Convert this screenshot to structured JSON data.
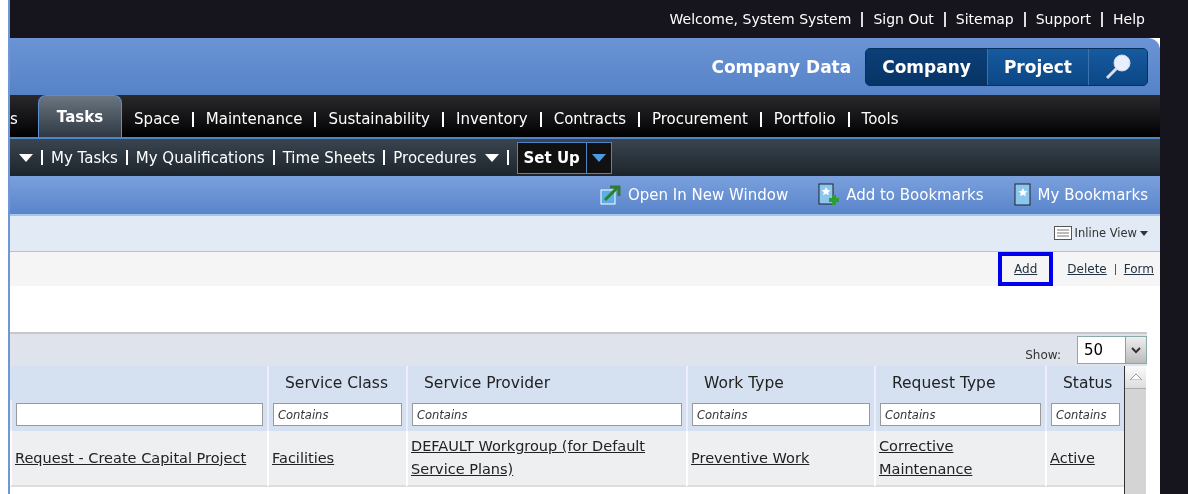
{
  "top_links": [
    "Welcome, System System",
    "Sign Out",
    "Sitemap",
    "Support",
    "Help"
  ],
  "header": {
    "title": "Company Data",
    "scopes": [
      {
        "label": "Company",
        "selected": true
      },
      {
        "label": "Project",
        "selected": false
      }
    ]
  },
  "main_tabs": [
    {
      "label": "s",
      "selected": false
    },
    {
      "label": "Tasks",
      "selected": true
    },
    {
      "label": "Space",
      "selected": false
    },
    {
      "label": "Maintenance",
      "selected": false
    },
    {
      "label": "Sustainability",
      "selected": false
    },
    {
      "label": "Inventory",
      "selected": false
    },
    {
      "label": "Contracts",
      "selected": false
    },
    {
      "label": "Procurement",
      "selected": false
    },
    {
      "label": "Portfolio",
      "selected": false
    },
    {
      "label": "Tools",
      "selected": false
    }
  ],
  "sub_nav": [
    {
      "label": "My Tasks",
      "dropdown": false,
      "selected": false
    },
    {
      "label": "My Qualifications",
      "dropdown": false,
      "selected": false
    },
    {
      "label": "Time Sheets",
      "dropdown": false,
      "selected": false
    },
    {
      "label": "Procedures",
      "dropdown": true,
      "selected": false
    },
    {
      "label": "Set Up",
      "dropdown": true,
      "selected": true
    }
  ],
  "toolbar": [
    {
      "kind": "open",
      "label": "Open In New Window"
    },
    {
      "kind": "add-bookmark",
      "label": "Add to Bookmarks"
    },
    {
      "kind": "bookmarks",
      "label": "My Bookmarks"
    }
  ],
  "view_menu": {
    "label": "Inline View"
  },
  "actions": [
    {
      "label": "Add",
      "highlighted": true
    },
    {
      "label": "Delete",
      "highlighted": false
    },
    {
      "label": "Form",
      "highlighted": false
    }
  ],
  "show": {
    "label": "Show:",
    "value": "50"
  },
  "table": {
    "columns": [
      {},
      {
        "label": "Service Class",
        "placeholder": "Contains"
      },
      {
        "label": "Service Provider",
        "placeholder": "Contains"
      },
      {
        "label": "Work Type",
        "placeholder": "Contains"
      },
      {
        "label": "Request Type",
        "placeholder": "Contains"
      },
      {
        "label": "Status",
        "placeholder": "Contains"
      }
    ],
    "rows": [
      {
        "cells": [
          "Request - Create Capital Project",
          "Facilities",
          "DEFAULT Workgroup (for Default Service Plans)",
          "Preventive Work",
          "Corrective Maintenance",
          "Active"
        ]
      }
    ]
  }
}
